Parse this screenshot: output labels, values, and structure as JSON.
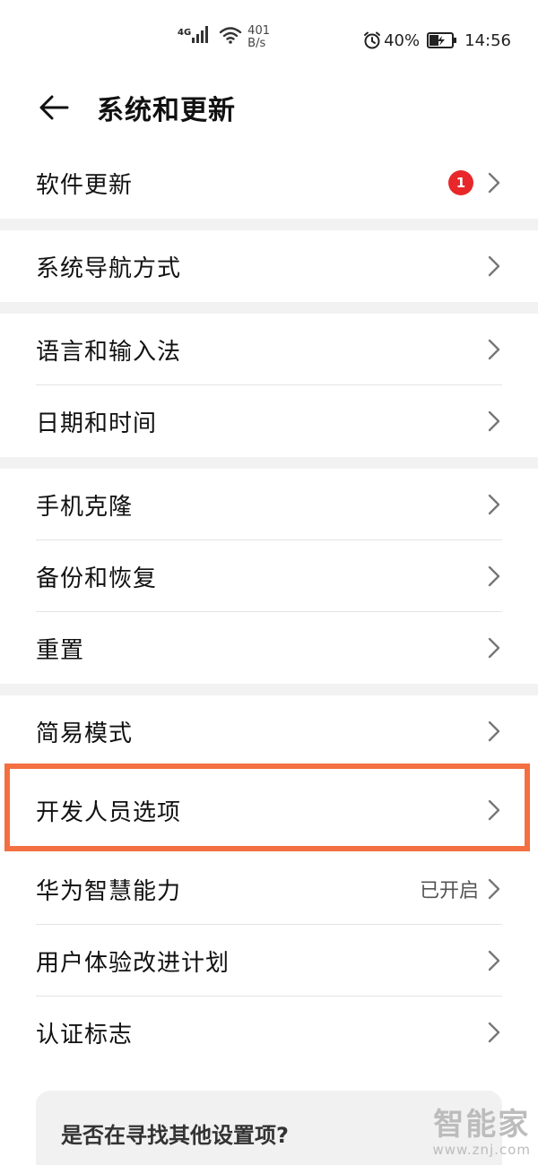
{
  "status_bar": {
    "network_type": "4G",
    "speed_value": "401",
    "speed_unit": "B/s",
    "battery_percent": "40%",
    "time": "14:56"
  },
  "header": {
    "title": "系统和更新",
    "back_icon": "arrow-left-icon"
  },
  "list": {
    "software_update": {
      "label": "软件更新",
      "badge": "1"
    },
    "navigation": {
      "label": "系统导航方式"
    },
    "language": {
      "label": "语言和输入法"
    },
    "datetime": {
      "label": "日期和时间"
    },
    "phone_clone": {
      "label": "手机克隆"
    },
    "backup": {
      "label": "备份和恢复"
    },
    "reset": {
      "label": "重置"
    },
    "simple_mode": {
      "label": "简易模式"
    },
    "developer": {
      "label": "开发人员选项"
    },
    "huawei_ai": {
      "label": "华为智慧能力",
      "value": "已开启"
    },
    "ux_plan": {
      "label": "用户体验改进计划"
    },
    "certification": {
      "label": "认证标志"
    }
  },
  "suggest": {
    "title": "是否在寻找其他设置项?"
  },
  "watermark": {
    "logo": "智能家",
    "url": "www.znj.com"
  },
  "colors": {
    "highlight": "#f46f41",
    "badge": "#e8272a",
    "section_gap": "#f2f2f2"
  }
}
